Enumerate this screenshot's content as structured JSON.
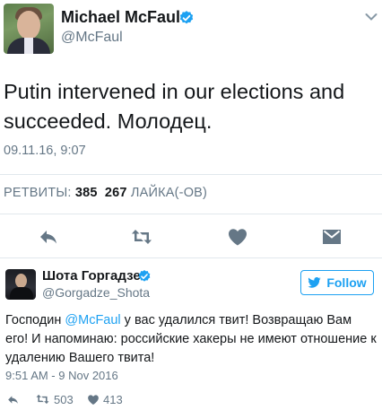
{
  "tweet": {
    "author_name": "Michael McFaul",
    "author_handle": "@McFaul",
    "text": "Putin intervened in our elections and succeeded. Молодец.",
    "timestamp": "09.11.16, 9:07",
    "stats": {
      "retweets_label": "РЕТВИТЫ:",
      "retweets_count": "385",
      "likes_count": "267",
      "likes_label": "ЛАЙКА(-ОВ)"
    },
    "actions": [
      "reply-icon",
      "retweet-icon",
      "like-icon",
      "message-icon"
    ]
  },
  "embedded_tweet": {
    "author_name": "Шота Горгадзе",
    "author_handle": "@Gorgadze_Shota",
    "follow_label": "Follow",
    "text_before_mention": "Господин ",
    "mention": "@McFaul",
    "text_after_mention": " у вас удалился твит! Возвращаю Вам его! И напоминаю: российские хакеры не имеют отношение к удалению Вашего твита!",
    "timestamp": "9:51 AM - 9 Nov 2016",
    "retweet_count": "503",
    "like_count": "413"
  },
  "colors": {
    "accent": "#1da1f2",
    "secondary_text": "#657786",
    "primary_text": "#14171a",
    "divider": "#e1e8ed"
  }
}
